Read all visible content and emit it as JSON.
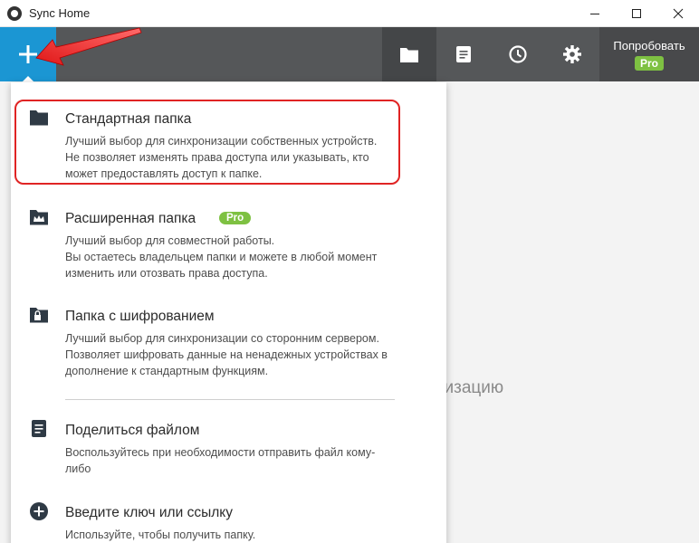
{
  "window": {
    "title": "Sync Home",
    "controls": [
      "–",
      "☐",
      "✕"
    ]
  },
  "toolbar": {
    "add_icon": "plus-icon",
    "buttons": [
      {
        "icon": "folder-icon"
      },
      {
        "icon": "document-icon"
      },
      {
        "icon": "clock-icon"
      },
      {
        "icon": "gear-icon"
      }
    ],
    "try_label": "Попробовать",
    "pro_badge": "Pro"
  },
  "background": {
    "text": "низацию"
  },
  "menu": {
    "items": [
      {
        "title": "Стандартная папка",
        "icon": "folder-icon",
        "desc": [
          "Лучший выбор для синхронизации собственных устройств.",
          "Не позволяет изменять права доступа или указывать, кто",
          "может предоставлять доступ к папке."
        ]
      },
      {
        "title": "Расширенная папка",
        "icon": "crown-folder-icon",
        "badge": "Pro",
        "desc": [
          "Лучший выбор для совместной работы.",
          "Вы остаетесь владельцем папки и можете в любой момент",
          "изменить или отозвать права доступа."
        ]
      },
      {
        "title": "Папка с шифрованием",
        "icon": "lock-folder-icon",
        "desc": [
          "Лучший выбор для синхронизации со сторонним сервером.",
          "Позволяет шифровать данные на ненадежных устройствах в",
          "дополнение к стандартным функциям."
        ]
      },
      {
        "title": "Поделиться файлом",
        "icon": "document-icon",
        "desc": [
          "Воспользуйтесь при необходимости отправить файл кому-",
          "либо"
        ]
      },
      {
        "title": "Введите ключ или ссылку",
        "icon": "plus-circle-icon",
        "desc": [
          "Используйте, чтобы получить папку."
        ]
      }
    ]
  },
  "colors": {
    "accent": "#1b96d3",
    "toolbar": "#555759",
    "pro": "#7ec142",
    "highlight": "#e02424"
  }
}
